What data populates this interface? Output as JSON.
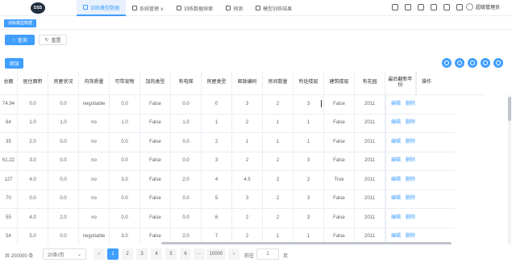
{
  "logo": {
    "text": "DSS"
  },
  "nav": {
    "tabs": [
      {
        "label": "训练模型数据"
      },
      {
        "label": "系统管理 ∨"
      },
      {
        "label": "训练数据探索"
      },
      {
        "label": "预测"
      },
      {
        "label": "模型训练结果"
      }
    ],
    "user": "超级管理员",
    "icons": [
      "history-icon",
      "refresh-icon",
      "expand-icon",
      "fullscreen-icon",
      "shirt-icon",
      "bell-icon"
    ]
  },
  "tag_bar": {
    "active_tag": "训练模型数据"
  },
  "toolbar": {
    "query_label": "查询",
    "reset_label": "重置",
    "add_label": "添加"
  },
  "table": {
    "headers": [
      "总额",
      "居住面积",
      "房屋状况",
      "内饰质量",
      "可带宠物",
      "加热类型",
      "有电梯",
      "房屋类型",
      "邮政编码",
      "房间数量",
      "所处楼层",
      "建筑楼层",
      "有花园",
      "最后翻新年份",
      "操作"
    ],
    "rows": [
      [
        "74.94",
        "0.0",
        "0.0",
        "negotiable",
        "0.0",
        "False",
        "0.0",
        "0",
        "3",
        "2",
        "3",
        "False",
        "2011"
      ],
      [
        "64",
        "1.0",
        "1.0",
        "no",
        "1.0",
        "False",
        "1.0",
        "1",
        "2",
        "1",
        "1",
        "False",
        "2011"
      ],
      [
        "35",
        "2.0",
        "0.0",
        "no",
        "0.0",
        "False",
        "0.0",
        "2",
        "1",
        "1",
        "1",
        "False",
        "2011"
      ],
      [
        "61.22",
        "3.0",
        "0.0",
        "no",
        "0.0",
        "False",
        "0.0",
        "3",
        "2",
        "2",
        "3",
        "False",
        "2011"
      ],
      [
        "127",
        "4.0",
        "0.0",
        "no",
        "3.0",
        "False",
        "2.0",
        "4",
        "4.5",
        "2",
        "2",
        "True",
        "2011"
      ],
      [
        "70",
        "0.0",
        "0.0",
        "no",
        "0.0",
        "False",
        "0.0",
        "5",
        "3",
        "2",
        "3",
        "False",
        "2011"
      ],
      [
        "55",
        "4.0",
        "2.0",
        "no",
        "0.0",
        "False",
        "0.0",
        "6",
        "2",
        "2",
        "3",
        "False",
        "2011"
      ],
      [
        "54",
        "5.0",
        "0.0",
        "negotiable",
        "3.0",
        "False",
        "2.0",
        "7",
        "2",
        "1",
        "1",
        "False",
        "2011"
      ]
    ],
    "op_edit": "编辑",
    "op_delete": "删除"
  },
  "pagination": {
    "total": "共 200000 条",
    "page_size": "20条/页",
    "pages": [
      "1",
      "2",
      "3",
      "4",
      "5",
      "6",
      "···",
      "10000"
    ],
    "goto_prefix": "前往",
    "goto_value": "1",
    "goto_suffix": "页",
    "prev": "‹",
    "next": "›"
  },
  "colors": {
    "accent": "#409eff",
    "border": "#ebeef5"
  }
}
